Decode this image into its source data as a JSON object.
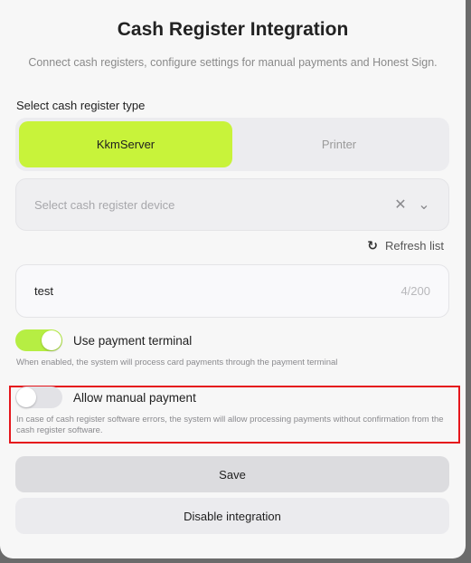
{
  "title": "Cash Register Integration",
  "subtitle": "Connect cash registers, configure settings for manual payments and Honest Sign.",
  "register_type": {
    "label": "Select cash register type",
    "tabs": [
      {
        "label": "KkmServer",
        "active": true
      },
      {
        "label": "Printer",
        "active": false
      }
    ]
  },
  "device_select": {
    "placeholder": "Select cash register device",
    "clear_icon": "close-icon",
    "expand_icon": "chevron-down-icon"
  },
  "refresh": {
    "label": "Refresh list",
    "icon": "refresh-icon"
  },
  "name_input": {
    "value": "test",
    "counter": "4/200"
  },
  "payment_terminal": {
    "label": "Use payment terminal",
    "enabled": true,
    "hint": "When enabled, the system will process card payments through the payment terminal"
  },
  "manual_payment": {
    "label": "Allow manual payment",
    "enabled": false,
    "hint": "In case of cash register software errors, the system will allow processing payments without confirmation from the cash register software."
  },
  "buttons": {
    "save": "Save",
    "disable": "Disable integration"
  },
  "colors": {
    "accent": "#c8f33a",
    "highlight": "#e5161c"
  }
}
